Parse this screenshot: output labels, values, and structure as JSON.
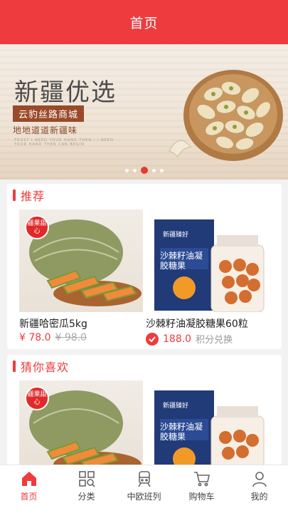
{
  "header": {
    "title": "首页"
  },
  "banner": {
    "title": "新疆优选",
    "tag": "云豹丝路商城",
    "subtitle": "地地道道新疆味",
    "tiny_text": "TRUST I NEED YOUR HAND THEN / I NEED YOUR HAND THEN CAN BEGIN",
    "dots": 5,
    "active_dot": 3
  },
  "sections": [
    {
      "title": "推荐",
      "products": [
        {
          "name": "新疆哈密瓜5kg",
          "price": "¥ 78.0",
          "old_price": "¥ 98.0",
          "badge": "疆果甜心",
          "jar_title": ""
        },
        {
          "name": "沙棘籽油凝胶糖果60粒",
          "price": "188.0",
          "points_label": "积分兑换",
          "jar_title": "沙棘籽油凝胶糖果",
          "brand": "新疆臻好"
        }
      ]
    },
    {
      "title": "猜你喜欢",
      "products": [
        {
          "badge": "疆果甜心"
        },
        {
          "jar_title": "沙棘籽油凝胶糖果",
          "brand": "新疆臻好"
        }
      ]
    }
  ],
  "tabbar": [
    {
      "label": "首页",
      "icon": "home-icon",
      "active": true
    },
    {
      "label": "分类",
      "icon": "category-icon",
      "active": false
    },
    {
      "label": "中欧班列",
      "icon": "train-icon",
      "active": false
    },
    {
      "label": "购物车",
      "icon": "cart-icon",
      "active": false
    },
    {
      "label": "我的",
      "icon": "user-icon",
      "active": false
    }
  ],
  "colors": {
    "accent": "#ee3b3d",
    "banner_tag": "#9a4a2a"
  }
}
